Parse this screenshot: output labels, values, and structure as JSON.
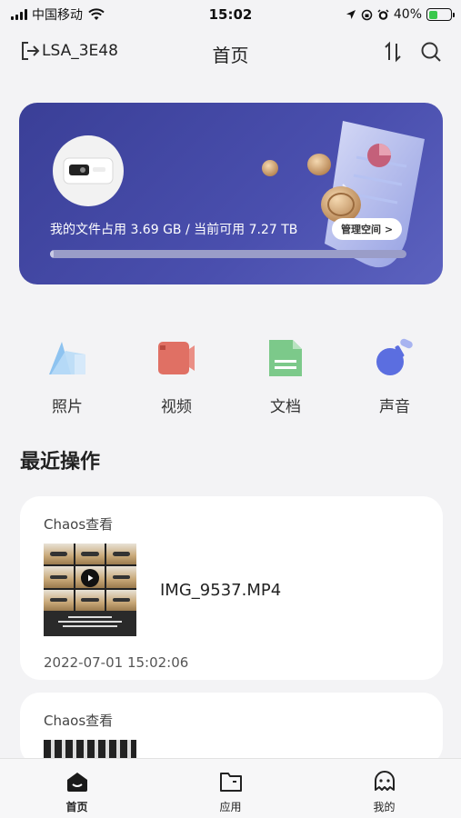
{
  "status_bar": {
    "carrier": "中国移动",
    "time": "15:02",
    "battery": "40%",
    "battery_level": 0.4
  },
  "header": {
    "device_name": "LSA_3E48",
    "title": "首页"
  },
  "storage": {
    "usage_text": "我的文件占用 3.69 GB / 当前可用 7.27 TB",
    "manage_label": "管理空间 >",
    "used_fraction": 0.0005
  },
  "categories": [
    {
      "label": "照片",
      "icon": "photo-icon",
      "color": "#8ec3f0"
    },
    {
      "label": "视频",
      "icon": "video-icon",
      "color": "#e07064"
    },
    {
      "label": "文档",
      "icon": "document-icon",
      "color": "#7cc98a"
    },
    {
      "label": "声音",
      "icon": "audio-icon",
      "color": "#5b6ee0"
    }
  ],
  "recent": {
    "title": "最近操作",
    "items": [
      {
        "user_action": "Chaos查看",
        "file_name": "IMG_9537.MP4",
        "time": "2022-07-01 15:02:06"
      },
      {
        "user_action": "Chaos查看"
      }
    ]
  },
  "bottom_nav": [
    {
      "label": "首页",
      "icon": "home-icon",
      "active": true
    },
    {
      "label": "应用",
      "icon": "folder-icon",
      "active": false
    },
    {
      "label": "我的",
      "icon": "profile-icon",
      "active": false
    }
  ],
  "colors": {
    "card_bg": "#3a3f97",
    "page_bg": "#f3f3f5",
    "battery_green": "#3ac84c"
  }
}
